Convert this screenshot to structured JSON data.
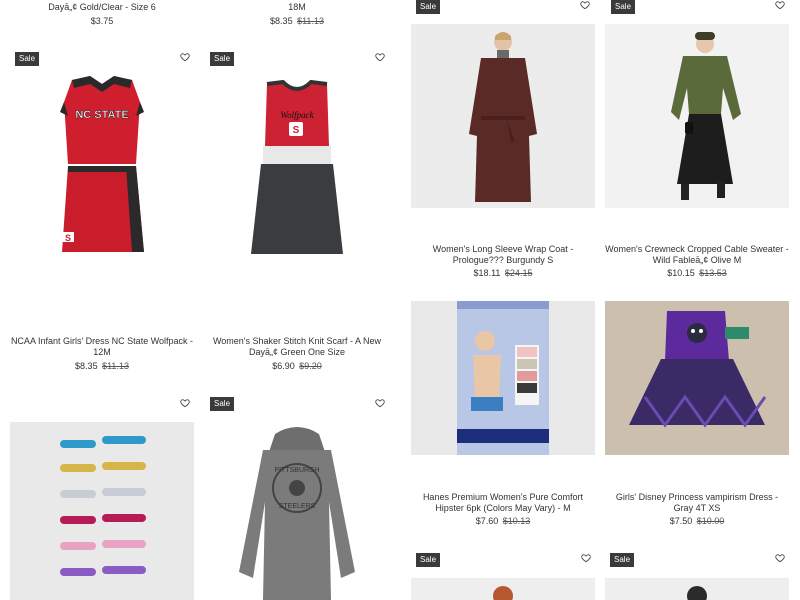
{
  "sale_label": "Sale",
  "products": {
    "top_left": {
      "title_line": "Dayā„¢ Gold/Clear - Size 6",
      "price": "$3.75"
    },
    "top_mid": {
      "title_line": "18M",
      "price": "$8.35",
      "old_price": "$11.13"
    },
    "ncaa_dress": {
      "title": "NCAA Infant Girls' Dress NC State Wolfpack - 12M",
      "price": "$8.35",
      "old_price": "$11.13"
    },
    "scarf_dress": {
      "title": "Women's Shaker Stitch Knit Scarf - A New Dayā„¢ Green One Size",
      "price": "$6.90",
      "old_price": "$9.20"
    },
    "wrap_coat": {
      "title": "Women's Long Sleeve Wrap Coat - Prologue??? Burgundy S",
      "price": "$18.11",
      "old_price": "$24.15"
    },
    "cable_sweater": {
      "title": "Women's Crewneck Cropped Cable Sweater - Wild Fableā„¢ Olive M",
      "price": "$10.15",
      "old_price": "$13.53"
    },
    "hanes": {
      "title": "Hanes Premium Women's Pure Comfort Hipster 6pk (Colors May Vary) - M",
      "price": "$7.60",
      "old_price": "$10.13"
    },
    "vampirism_dress": {
      "title": "Girls' Disney Princess vampirism Dress - Gray 4T XS",
      "price": "$7.50",
      "old_price": "$10.00"
    },
    "hair_clips": {},
    "steelers_hoodie": {
      "print_top": "PITTSBURGH",
      "print_bottom": "STEELERS"
    }
  },
  "ncaa_print": "NC STATE",
  "wolfpack_print": "Wolfpack",
  "icons": {
    "wishlist": "heart-outline-icon"
  },
  "colors": {
    "badge": "#3a3a3a",
    "text": "#333333"
  }
}
